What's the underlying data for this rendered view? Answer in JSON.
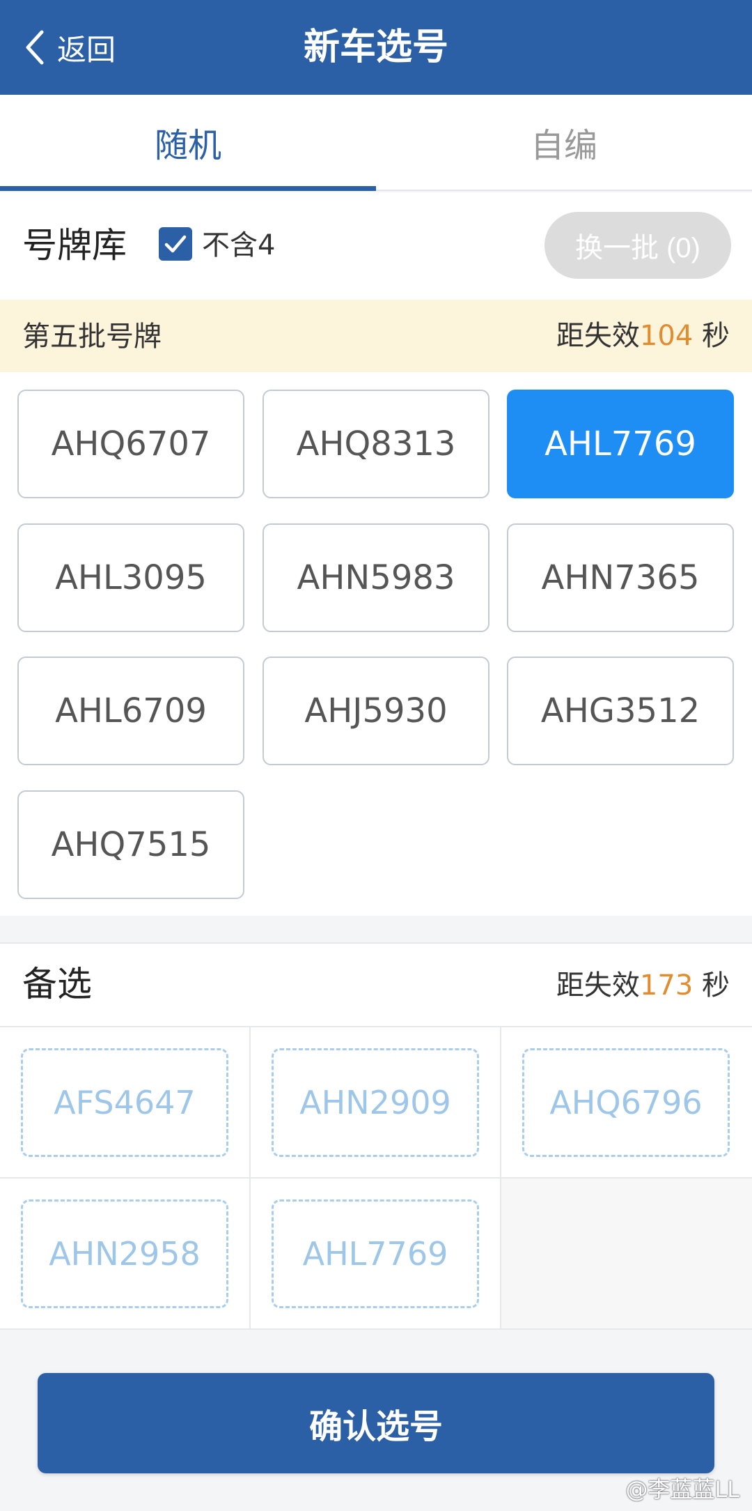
{
  "header": {
    "back_label": "返回",
    "title": "新车选号"
  },
  "tabs": [
    {
      "label": "随机",
      "active": true
    },
    {
      "label": "自编",
      "active": false
    }
  ],
  "pool": {
    "label": "号牌库",
    "exclude_four_label": "不含4",
    "exclude_four_checked": true,
    "refresh_label": "换一批 (0)"
  },
  "batch": {
    "title": "第五批号牌",
    "timer_prefix": "距失效",
    "timer_seconds": "104",
    "timer_suffix": "秒"
  },
  "plates": [
    {
      "number": "AHQ6707",
      "selected": false
    },
    {
      "number": "AHQ8313",
      "selected": false
    },
    {
      "number": "AHL7769",
      "selected": true
    },
    {
      "number": "AHL3095",
      "selected": false
    },
    {
      "number": "AHN5983",
      "selected": false
    },
    {
      "number": "AHN7365",
      "selected": false
    },
    {
      "number": "AHL6709",
      "selected": false
    },
    {
      "number": "AHJ5930",
      "selected": false
    },
    {
      "number": "AHG3512",
      "selected": false
    },
    {
      "number": "AHQ7515",
      "selected": false
    }
  ],
  "alternates": {
    "title": "备选",
    "timer_prefix": "距失效",
    "timer_seconds": "173",
    "timer_suffix": "秒",
    "items": [
      "AFS4647",
      "AHN2909",
      "AHQ6796",
      "AHN2958",
      "AHL7769"
    ]
  },
  "confirm_label": "确认选号",
  "watermark": "@李蓝蓝LL",
  "colors": {
    "primary": "#2b5fa6",
    "selected": "#1e8ef5",
    "timer": "#e38b2f",
    "notice_bg": "#fdf4dc"
  }
}
